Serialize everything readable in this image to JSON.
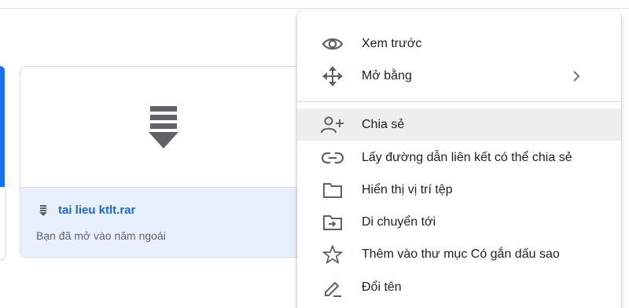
{
  "file_card": {
    "name": "tai lieu ktlt.rar",
    "subtitle": "Bạn đã mở vào năm ngoái",
    "file_icon": "archive-icon"
  },
  "context_menu": {
    "items": [
      {
        "label": "Xem trước",
        "icon": "eye-icon"
      },
      {
        "label": "Mở bằng",
        "icon": "move-arrows-icon",
        "submenu_icon": "chevron-right-icon"
      },
      {
        "label": "Chia sẻ",
        "icon": "add-person-icon",
        "highlighted": true
      },
      {
        "label": "Lấy đường dẫn liên kết có thể chia sẻ",
        "icon": "link-icon"
      },
      {
        "label": "Hiển thị vị trí tệp",
        "icon": "folder-icon"
      },
      {
        "label": "Di chuyển tới",
        "icon": "move-to-folder-icon"
      },
      {
        "label": "Thêm vào thư mục Có gắn dấu sao",
        "icon": "star-icon"
      },
      {
        "label": "Đổi tên",
        "icon": "pencil-icon"
      }
    ]
  },
  "colors": {
    "accent": "#1a73e8",
    "file_name": "#1967d2",
    "selected_card_bg": "#e8f0fe",
    "icon_gray": "#5f6368",
    "menu_highlight": "#eeeeee"
  }
}
